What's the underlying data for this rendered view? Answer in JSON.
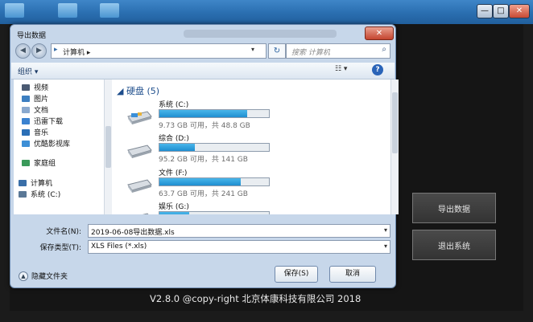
{
  "app": {
    "minimize_glyph": "—",
    "maximize_glyph": "□",
    "close_glyph": "✕",
    "export_button": "导出数据",
    "exit_button": "退出系统",
    "footer": "V2.8.0    @copy-right  北京体康科技有限公司  2018"
  },
  "dialog": {
    "title": "导出数据",
    "close_glyph": "✕",
    "address": "计算机  ▸",
    "address_prefix": "▸",
    "refresh_glyph": "↻",
    "search_placeholder": "搜索 计算机",
    "search_glyph": "⌕",
    "organize": "组织 ▾",
    "view_glyph": "☷ ▾",
    "help_glyph": "?",
    "sidebar": [
      {
        "label": "视频",
        "icon": "video-icon",
        "color": "#4a5a72"
      },
      {
        "label": "图片",
        "icon": "picture-icon",
        "color": "#3d7fc1"
      },
      {
        "label": "文档",
        "icon": "document-icon",
        "color": "#8aa9cf"
      },
      {
        "label": "迅雷下载",
        "icon": "download-icon",
        "color": "#3b82d0"
      },
      {
        "label": "音乐",
        "icon": "music-icon",
        "color": "#2b6fb6"
      },
      {
        "label": "优酷影视库",
        "icon": "library-icon",
        "color": "#3d8fd6"
      },
      {
        "label": "家庭组",
        "icon": "homegroup-icon",
        "color": "#3a9a5a"
      },
      {
        "label": "计算机",
        "icon": "computer-icon",
        "color": "#3a6fa8"
      },
      {
        "label": "系统 (C:)",
        "icon": "drive-c-icon",
        "color": "#5a7896"
      }
    ],
    "group_header": "◢ 硬盘 (5)",
    "drives": [
      {
        "name": "系统 (C:)",
        "info": "9.73 GB 可用，共 48.8 GB",
        "used_fraction": 0.8
      },
      {
        "name": "综合 (D:)",
        "info": "95.2 GB 可用，共 141 GB",
        "used_fraction": 0.32
      },
      {
        "name": "文件 (F:)",
        "info": "63.7 GB 可用，共 241 GB",
        "used_fraction": 0.74
      },
      {
        "name": "娱乐 (G:)",
        "info": "",
        "used_fraction": 0.27
      }
    ],
    "filename_label": "文件名(N):",
    "filename_value": "2019-06-08导出数据.xls",
    "filetype_label": "保存类型(T):",
    "filetype_value": "XLS Files (*.xls)",
    "dropdown_glyph": "▾",
    "hide_folders": "隐藏文件夹",
    "hide_glyph": "▲",
    "save_button": "保存(S)",
    "cancel_button": "取消"
  }
}
